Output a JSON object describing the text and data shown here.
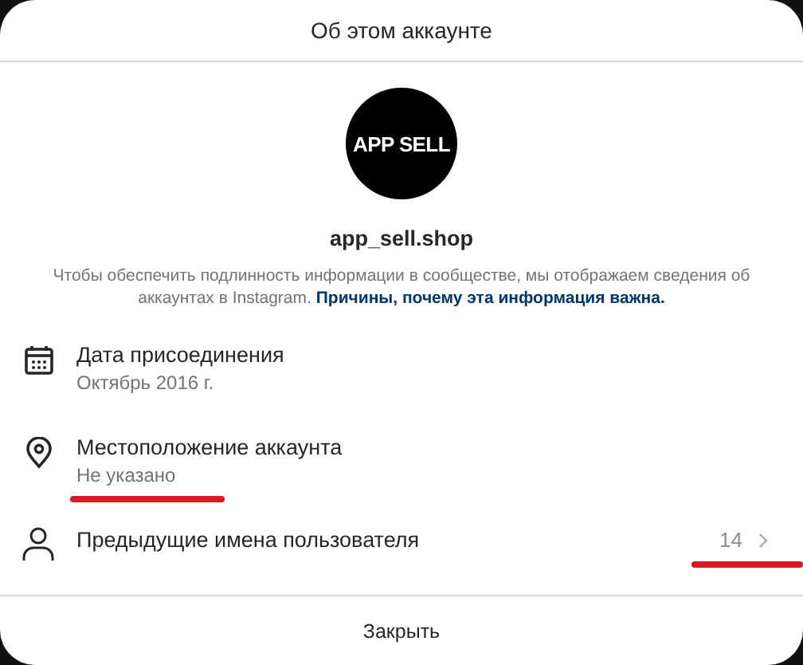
{
  "dialog": {
    "title": "Об этом аккаунте"
  },
  "profile": {
    "avatar_text": "APP SELL",
    "username": "app_sell.shop",
    "description": "Чтобы обеспечить подлинность информации в сообществе, мы отображаем сведения об аккаунтах в Instagram.",
    "link": "Причины, почему эта информация важна."
  },
  "items": [
    {
      "kind": "calendar",
      "title": "Дата присоединения",
      "value": "Октябрь 2016 г.",
      "underlined": false
    },
    {
      "kind": "location",
      "title": "Местоположение аккаунта",
      "value": "Не указано",
      "underlined": true
    },
    {
      "kind": "person",
      "title": "Предыдущие имена пользователя",
      "count": "14",
      "underlined": true
    }
  ],
  "close_button": "Закрыть"
}
